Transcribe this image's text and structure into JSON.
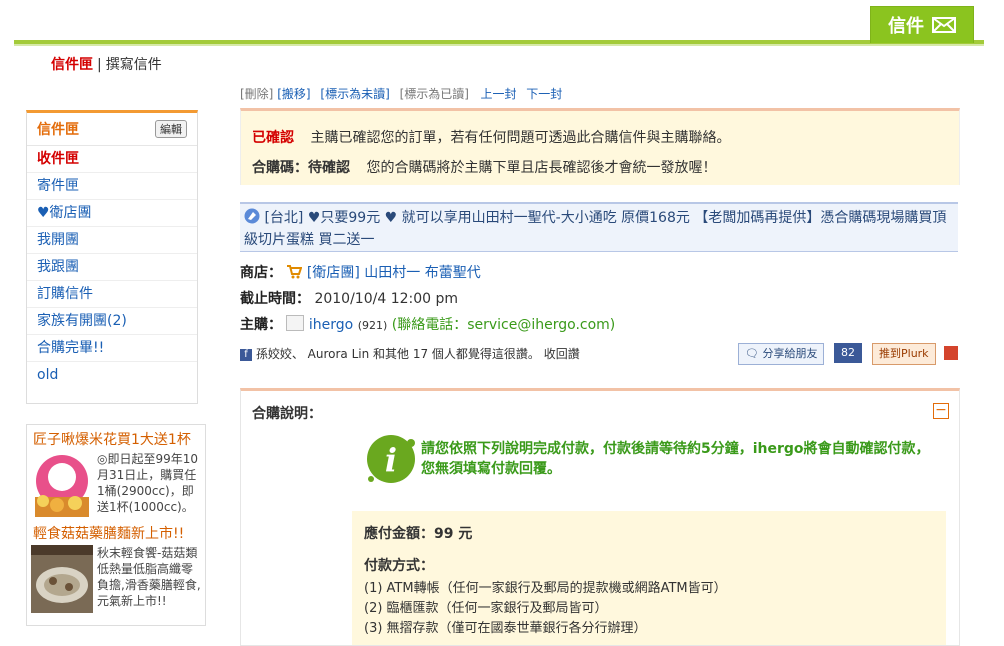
{
  "header": {
    "mail_tab": "信件"
  },
  "submenu": {
    "inbox": "信件匣",
    "separator": "|",
    "compose": "撰寫信件"
  },
  "sidebar": {
    "title": "信件匣",
    "edit": "編輯",
    "items": [
      "收件匣",
      "寄件匣",
      "♥衛店團",
      "我開團",
      "我跟團",
      "訂購信件",
      "家族有開團(2)",
      "合購完畢!!",
      "old"
    ]
  },
  "ads": [
    {
      "title": "匠子啾爆米花買1大送1杯",
      "text": "◎即日起至99年10月31日止，購買任1桶(2900cc)，即送1杯(1000cc)。"
    },
    {
      "title": "輕食菇菇藥膳麵新上市!!",
      "text": "秋末輕食饗-菇菇類低熱量低脂高纖零負擔,滑香藥膳輕食,元氣新上市!!"
    }
  ],
  "toolbar": {
    "delete": "[刪除]",
    "move": "[搬移]",
    "mark_unread": "[標示為未讀]",
    "mark_read": "[標示為已讀]",
    "prev": "上一封",
    "next": "下一封"
  },
  "confirm": {
    "label": "已確認",
    "text": "主購已確認您的訂單，若有任何問題可透過此合購信件與主購聯絡。",
    "code_label": "合購碼：待確認",
    "code_text": "您的合購碼將於主購下單且店長確認後才會統一發放喔！"
  },
  "subject": "[台北] ♥只要99元 ♥ 就可以享用山田村一聖代-大小通吃 原價168元 【老闆加碼再提供】憑合購碼現場購買頂級切片蛋糕 買二送一",
  "details": {
    "store_label": "商店：",
    "store_value": "[衛店團] 山田村一 布蕾聖代",
    "deadline_label": "截止時間：",
    "deadline_value": "2010/10/4  12:00 pm",
    "owner_label": "主購：",
    "owner_name": "ihergo",
    "owner_count": "(921)",
    "contact": "(聯絡電話：service@ihergo.com)"
  },
  "social": {
    "likes_text": "孫姣姣、 Aurora Lin 和其他 17 個人都覺得這很讚。",
    "recall": "收回讚",
    "share": "分享給朋友",
    "share_count": "82",
    "plurk": "推到Plurk"
  },
  "explain": {
    "title": "合購說明：",
    "note": "請您依照下列說明完成付款，付款後請等待約5分鐘，ihergo將會自動確認付款，您無須填寫付款回覆。",
    "amount": "應付金額：99 元",
    "method_header": "付款方式：",
    "methods": [
      "(1) ATM轉帳（任何一家銀行及郵局的提款機或網路ATM皆可）",
      "(2) 臨櫃匯款（任何一家銀行及郵局皆可）",
      "(3) 無摺存款（僅可在國泰世華銀行各分行辦理）"
    ]
  },
  "colors": {
    "accent_green": "#8bc41f",
    "alert_red": "#d40000",
    "orange": "#e36c0a",
    "link_blue": "#1a5fb4"
  }
}
